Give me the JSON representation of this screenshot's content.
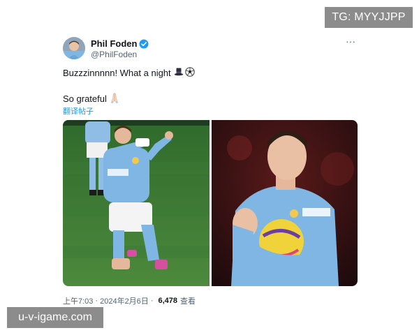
{
  "watermarks": {
    "top": "TG: MYYJJPP",
    "bottom": "u-v-igame.com"
  },
  "tweet": {
    "display_name": "Phil Foden",
    "handle": "@PhilFoden",
    "text_line_1": "Buzzzinnnnn! What a night",
    "text_line_2": "So grateful",
    "translate_link": "翻译帖子",
    "time": "上午7:03",
    "date": "2024年2月6日",
    "separator": "·",
    "views_count": "6,478",
    "views_label": "查看"
  },
  "icons": {
    "verified": "verified-badge-icon",
    "more": "more-options-icon",
    "top_hat": "top-hat-emoji",
    "soccer_ball": "soccer-ball-emoji",
    "praying_hands": "praying-hands-emoji"
  },
  "colors": {
    "accent": "#1d9bf0",
    "text_primary": "#0f1419",
    "text_secondary": "#536471",
    "watermark_bg": "#8c8c8c",
    "kit_sky_blue": "#7fb6e4",
    "pitch_green": "#3f7a34"
  }
}
